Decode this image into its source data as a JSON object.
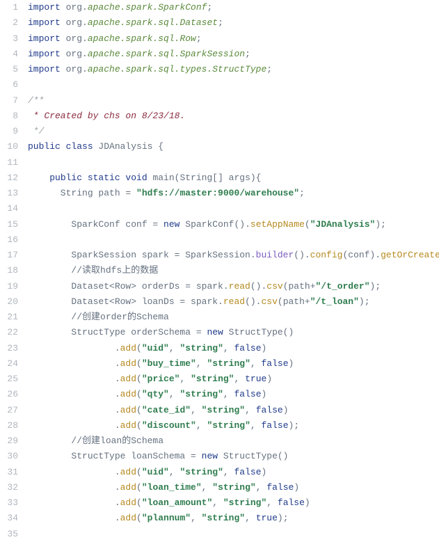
{
  "line_count": 35,
  "lines": [
    [
      {
        "cls": "kw",
        "t": "import"
      },
      {
        "cls": "ide",
        "t": " org."
      },
      {
        "cls": "pkg",
        "t": "apache.spark.SparkConf"
      },
      {
        "cls": "punc",
        "t": ";"
      }
    ],
    [
      {
        "cls": "kw",
        "t": "import"
      },
      {
        "cls": "ide",
        "t": " org."
      },
      {
        "cls": "pkg",
        "t": "apache.spark.sql.Dataset"
      },
      {
        "cls": "punc",
        "t": ";"
      }
    ],
    [
      {
        "cls": "kw",
        "t": "import"
      },
      {
        "cls": "ide",
        "t": " org."
      },
      {
        "cls": "pkg",
        "t": "apache.spark.sql.Row"
      },
      {
        "cls": "punc",
        "t": ";"
      }
    ],
    [
      {
        "cls": "kw",
        "t": "import"
      },
      {
        "cls": "ide",
        "t": " org."
      },
      {
        "cls": "pkg",
        "t": "apache.spark.sql.SparkSession"
      },
      {
        "cls": "punc",
        "t": ";"
      }
    ],
    [
      {
        "cls": "kw",
        "t": "import"
      },
      {
        "cls": "ide",
        "t": " org."
      },
      {
        "cls": "pkg",
        "t": "apache.spark.sql.types.StructType"
      },
      {
        "cls": "punc",
        "t": ";"
      }
    ],
    [],
    [
      {
        "cls": "comment-star",
        "t": "/**"
      }
    ],
    [
      {
        "cls": "doc",
        "t": " * Created by chs on 8/23/18."
      }
    ],
    [
      {
        "cls": "comment-star",
        "t": " */"
      }
    ],
    [
      {
        "cls": "kw",
        "t": "public class "
      },
      {
        "cls": "ide",
        "t": "JDAnalysis {"
      }
    ],
    [],
    [
      {
        "cls": "ide",
        "t": "    "
      },
      {
        "cls": "kw",
        "t": "public static void "
      },
      {
        "cls": "ide",
        "t": "main(String[] args){"
      }
    ],
    [
      {
        "cls": "ide",
        "t": "      String path = "
      },
      {
        "cls": "str",
        "t": "\"hdfs://master:9000/warehouse\""
      },
      {
        "cls": "punc",
        "t": ";"
      }
    ],
    [],
    [
      {
        "cls": "ide",
        "t": "        SparkConf conf = "
      },
      {
        "cls": "kw",
        "t": "new "
      },
      {
        "cls": "ide",
        "t": "SparkConf()."
      },
      {
        "cls": "method",
        "t": "setAppName"
      },
      {
        "cls": "ide",
        "t": "("
      },
      {
        "cls": "str",
        "t": "\"JDAnalysis\""
      },
      {
        "cls": "ide",
        "t": ");"
      }
    ],
    [],
    [
      {
        "cls": "ide",
        "t": "        SparkSession spark = SparkSession."
      },
      {
        "cls": "ctx",
        "t": "builder"
      },
      {
        "cls": "ide",
        "t": "()."
      },
      {
        "cls": "method",
        "t": "config"
      },
      {
        "cls": "ide",
        "t": "(conf)."
      },
      {
        "cls": "method",
        "t": "getOrCreate"
      },
      {
        "cls": "ide",
        "t": "();"
      }
    ],
    [
      {
        "cls": "ide",
        "t": "        //读取hdfs上的数据"
      }
    ],
    [
      {
        "cls": "ide",
        "t": "        Dataset<Row> orderDs = spark."
      },
      {
        "cls": "method",
        "t": "read"
      },
      {
        "cls": "ide",
        "t": "()."
      },
      {
        "cls": "method",
        "t": "csv"
      },
      {
        "cls": "ide",
        "t": "(path+"
      },
      {
        "cls": "str",
        "t": "\"/t_order\""
      },
      {
        "cls": "ide",
        "t": ");"
      }
    ],
    [
      {
        "cls": "ide",
        "t": "        Dataset<Row> loanDs = spark."
      },
      {
        "cls": "method",
        "t": "read"
      },
      {
        "cls": "ide",
        "t": "()."
      },
      {
        "cls": "method",
        "t": "csv"
      },
      {
        "cls": "ide",
        "t": "(path+"
      },
      {
        "cls": "str",
        "t": "\"/t_loan\""
      },
      {
        "cls": "ide",
        "t": ");"
      }
    ],
    [
      {
        "cls": "ide",
        "t": "        //创建order的Schema"
      }
    ],
    [
      {
        "cls": "ide",
        "t": "        StructType orderSchema = "
      },
      {
        "cls": "kw",
        "t": "new "
      },
      {
        "cls": "ide",
        "t": "StructType()"
      }
    ],
    [
      {
        "cls": "ide",
        "t": "                ."
      },
      {
        "cls": "method",
        "t": "add"
      },
      {
        "cls": "ide",
        "t": "("
      },
      {
        "cls": "str",
        "t": "\"uid\""
      },
      {
        "cls": "ide",
        "t": ", "
      },
      {
        "cls": "str",
        "t": "\"string\""
      },
      {
        "cls": "ide",
        "t": ", "
      },
      {
        "cls": "kw",
        "t": "false"
      },
      {
        "cls": "ide",
        "t": ")"
      }
    ],
    [
      {
        "cls": "ide",
        "t": "                ."
      },
      {
        "cls": "method",
        "t": "add"
      },
      {
        "cls": "ide",
        "t": "("
      },
      {
        "cls": "str",
        "t": "\"buy_time\""
      },
      {
        "cls": "ide",
        "t": ", "
      },
      {
        "cls": "str",
        "t": "\"string\""
      },
      {
        "cls": "ide",
        "t": ", "
      },
      {
        "cls": "kw",
        "t": "false"
      },
      {
        "cls": "ide",
        "t": ")"
      }
    ],
    [
      {
        "cls": "ide",
        "t": "                ."
      },
      {
        "cls": "method",
        "t": "add"
      },
      {
        "cls": "ide",
        "t": "("
      },
      {
        "cls": "str",
        "t": "\"price\""
      },
      {
        "cls": "ide",
        "t": ", "
      },
      {
        "cls": "str",
        "t": "\"string\""
      },
      {
        "cls": "ide",
        "t": ", "
      },
      {
        "cls": "kw",
        "t": "true"
      },
      {
        "cls": "ide",
        "t": ")"
      }
    ],
    [
      {
        "cls": "ide",
        "t": "                ."
      },
      {
        "cls": "method",
        "t": "add"
      },
      {
        "cls": "ide",
        "t": "("
      },
      {
        "cls": "str",
        "t": "\"qty\""
      },
      {
        "cls": "ide",
        "t": ", "
      },
      {
        "cls": "str",
        "t": "\"string\""
      },
      {
        "cls": "ide",
        "t": ", "
      },
      {
        "cls": "kw",
        "t": "false"
      },
      {
        "cls": "ide",
        "t": ")"
      }
    ],
    [
      {
        "cls": "ide",
        "t": "                ."
      },
      {
        "cls": "method",
        "t": "add"
      },
      {
        "cls": "ide",
        "t": "("
      },
      {
        "cls": "str",
        "t": "\"cate_id\""
      },
      {
        "cls": "ide",
        "t": ", "
      },
      {
        "cls": "str",
        "t": "\"string\""
      },
      {
        "cls": "ide",
        "t": ", "
      },
      {
        "cls": "kw",
        "t": "false"
      },
      {
        "cls": "ide",
        "t": ")"
      }
    ],
    [
      {
        "cls": "ide",
        "t": "                ."
      },
      {
        "cls": "method",
        "t": "add"
      },
      {
        "cls": "ide",
        "t": "("
      },
      {
        "cls": "str",
        "t": "\"discount\""
      },
      {
        "cls": "ide",
        "t": ", "
      },
      {
        "cls": "str",
        "t": "\"string\""
      },
      {
        "cls": "ide",
        "t": ", "
      },
      {
        "cls": "kw",
        "t": "false"
      },
      {
        "cls": "ide",
        "t": ");"
      }
    ],
    [
      {
        "cls": "ide",
        "t": "        //创建loan的Schema"
      }
    ],
    [
      {
        "cls": "ide",
        "t": "        StructType loanSchema = "
      },
      {
        "cls": "kw",
        "t": "new "
      },
      {
        "cls": "ide",
        "t": "StructType()"
      }
    ],
    [
      {
        "cls": "ide",
        "t": "                ."
      },
      {
        "cls": "method",
        "t": "add"
      },
      {
        "cls": "ide",
        "t": "("
      },
      {
        "cls": "str",
        "t": "\"uid\""
      },
      {
        "cls": "ide",
        "t": ", "
      },
      {
        "cls": "str",
        "t": "\"string\""
      },
      {
        "cls": "ide",
        "t": ", "
      },
      {
        "cls": "kw",
        "t": "false"
      },
      {
        "cls": "ide",
        "t": ")"
      }
    ],
    [
      {
        "cls": "ide",
        "t": "                ."
      },
      {
        "cls": "method",
        "t": "add"
      },
      {
        "cls": "ide",
        "t": "("
      },
      {
        "cls": "str",
        "t": "\"loan_time\""
      },
      {
        "cls": "ide",
        "t": ", "
      },
      {
        "cls": "str",
        "t": "\"string\""
      },
      {
        "cls": "ide",
        "t": ", "
      },
      {
        "cls": "kw",
        "t": "false"
      },
      {
        "cls": "ide",
        "t": ")"
      }
    ],
    [
      {
        "cls": "ide",
        "t": "                ."
      },
      {
        "cls": "method",
        "t": "add"
      },
      {
        "cls": "ide",
        "t": "("
      },
      {
        "cls": "str",
        "t": "\"loan_amount\""
      },
      {
        "cls": "ide",
        "t": ", "
      },
      {
        "cls": "str",
        "t": "\"string\""
      },
      {
        "cls": "ide",
        "t": ", "
      },
      {
        "cls": "kw",
        "t": "false"
      },
      {
        "cls": "ide",
        "t": ")"
      }
    ],
    [
      {
        "cls": "ide",
        "t": "                ."
      },
      {
        "cls": "method",
        "t": "add"
      },
      {
        "cls": "ide",
        "t": "("
      },
      {
        "cls": "str",
        "t": "\"plannum\""
      },
      {
        "cls": "ide",
        "t": ", "
      },
      {
        "cls": "str",
        "t": "\"string\""
      },
      {
        "cls": "ide",
        "t": ", "
      },
      {
        "cls": "kw",
        "t": "true"
      },
      {
        "cls": "ide",
        "t": ");"
      }
    ]
  ]
}
